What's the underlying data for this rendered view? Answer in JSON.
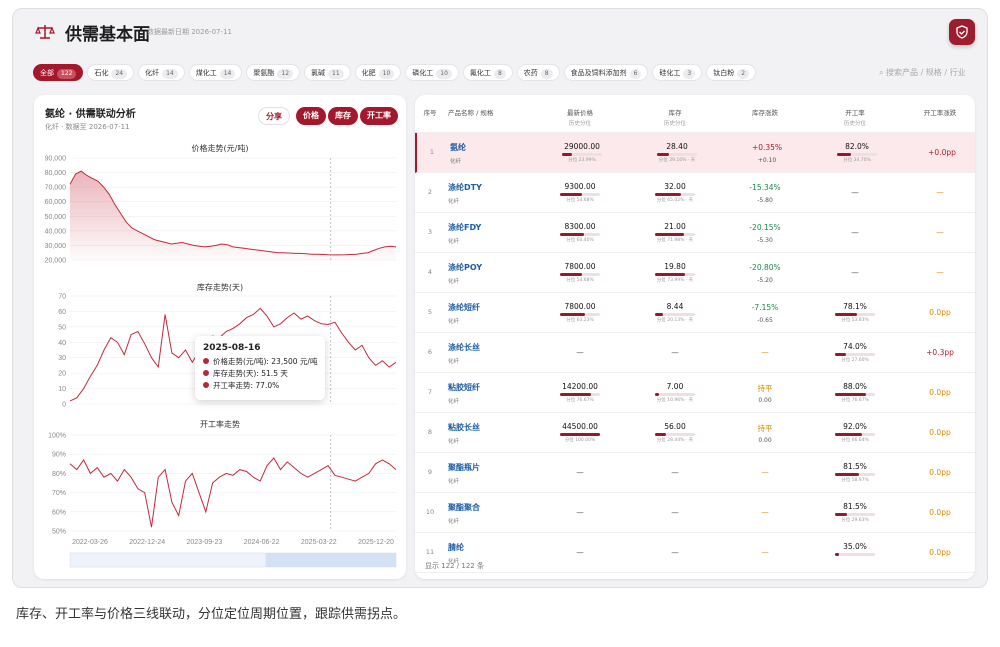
{
  "header": {
    "title": "供需基本面",
    "subtitle": "数据最新日期 2026-07-11",
    "search_placeholder": "搜索产品 / 规格 / 行业",
    "brand_color": "#a3192b"
  },
  "chips": [
    {
      "label": "全部",
      "count": "122"
    },
    {
      "label": "石化",
      "count": "24"
    },
    {
      "label": "化纤",
      "count": "14"
    },
    {
      "label": "煤化工",
      "count": "14"
    },
    {
      "label": "聚氨酯",
      "count": "12"
    },
    {
      "label": "氯碱",
      "count": "11"
    },
    {
      "label": "化肥",
      "count": "10"
    },
    {
      "label": "磷化工",
      "count": "10"
    },
    {
      "label": "氟化工",
      "count": "8"
    },
    {
      "label": "农药",
      "count": "8"
    },
    {
      "label": "食品及饲料添加剂",
      "count": "6"
    },
    {
      "label": "硅化工",
      "count": "3"
    },
    {
      "label": "钛白粉",
      "count": "2"
    }
  ],
  "left": {
    "title": "氨纶 · 供需联动分析",
    "subtitle": "化纤 · 数据至 2026-07-11",
    "buttons": {
      "share": "分享",
      "price": "价格",
      "stock": "库存",
      "rate": "开工率"
    }
  },
  "chart_data": [
    {
      "type": "area",
      "title": "价格走势(元/吨)",
      "ylim": [
        20000,
        90000
      ],
      "yticks": [
        "90,000",
        "80,000",
        "70,000",
        "60,000",
        "50,000",
        "40,000",
        "30,000",
        "20,000"
      ],
      "values": [
        72000,
        79000,
        81000,
        78000,
        76000,
        74000,
        70000,
        65000,
        58000,
        52000,
        46000,
        42000,
        40000,
        38000,
        36000,
        34000,
        33000,
        32000,
        31000,
        31500,
        32000,
        31000,
        30000,
        29500,
        29000,
        29500,
        30000,
        31000,
        30500,
        29000,
        28500,
        28000,
        27500,
        27000,
        26500,
        26000,
        25500,
        25000,
        25000,
        24800,
        24500,
        24500,
        24300,
        24000,
        24000,
        23800,
        23600,
        23500,
        23500,
        23600,
        23800,
        24000,
        24500,
        25000,
        26500,
        28000,
        29000,
        29500,
        29000
      ]
    },
    {
      "type": "line",
      "title": "库存走势(天)",
      "ylim": [
        0,
        70
      ],
      "yticks": [
        "70",
        "60",
        "50",
        "40",
        "30",
        "20",
        "10",
        "0"
      ],
      "values": [
        2,
        4,
        10,
        18,
        25,
        35,
        43,
        40,
        32,
        45,
        47,
        39,
        30,
        24,
        58,
        33,
        30,
        35,
        27,
        34,
        39,
        44,
        43,
        47,
        49,
        52,
        56,
        58,
        62,
        57,
        50,
        52,
        56,
        59,
        55,
        57,
        54,
        52,
        51.5,
        53,
        46,
        40,
        35,
        38,
        30,
        25,
        28,
        24,
        27
      ]
    },
    {
      "type": "line",
      "title": "开工率走势",
      "ylim": [
        50,
        100
      ],
      "yticks": [
        "100%",
        "90%",
        "80%",
        "70%",
        "60%",
        "50%"
      ],
      "x_ticks": [
        "2022-03-26",
        "2022-12-24",
        "2023-09-23",
        "2024-06-22",
        "2025-03-22",
        "2025-12-20"
      ],
      "values": [
        85,
        82,
        87,
        80,
        83,
        78,
        80,
        76,
        82,
        78,
        72,
        70,
        52,
        78,
        82,
        65,
        58,
        76,
        80,
        70,
        60,
        75,
        78,
        80,
        79,
        82,
        81,
        78,
        76,
        84,
        88,
        82,
        86,
        83,
        80,
        78,
        80,
        82,
        84,
        79,
        78,
        77,
        76,
        78,
        80,
        85,
        87,
        85,
        82
      ]
    }
  ],
  "tooltip": {
    "date": "2025-08-16",
    "price": "价格走势(元/吨): 23,500 元/吨",
    "stock": "库存走势(天): 51.5 天",
    "rate": "开工率走势: 77.0%"
  },
  "table": {
    "headers": {
      "no": "序号",
      "name": "产品名称 / 规格",
      "price": "最新价格",
      "price_s": "历史分位",
      "stock": "库存",
      "stock_s": "历史分位",
      "sidx": "库存涨跌",
      "rate": "开工率",
      "rate_s": "历史分位",
      "ridx": "开工率涨跌"
    },
    "rows": [
      {
        "no": "1",
        "name": "氨纶",
        "cat": "化纤",
        "price": "29000.00",
        "pp": "分位 23.99%",
        "pf": 0.24,
        "stock": "28.40",
        "sp": "分位 29.16% · 天",
        "sf": 0.29,
        "chg": "+0.35%",
        "chg2": "+0.10",
        "ct": "up",
        "rate": "82.0%",
        "rp": "分位 34.70%",
        "rf": 0.35,
        "rchg": "+0.0pp",
        "rt": "up"
      },
      {
        "no": "2",
        "name": "涤纶DTY",
        "cat": "化纤",
        "price": "9300.00",
        "pp": "分位 54.68%",
        "pf": 0.55,
        "stock": "32.00",
        "sp": "分位 65.02% · 天",
        "sf": 0.65,
        "chg": "-15.34%",
        "chg2": "-5.80",
        "ct": "dn",
        "rate": "—",
        "rp": "",
        "rf": 0,
        "rchg": "—",
        "rt": "fl"
      },
      {
        "no": "3",
        "name": "涤纶FDY",
        "cat": "化纤",
        "price": "8300.00",
        "pp": "分位 60.40%",
        "pf": 0.6,
        "stock": "21.00",
        "sp": "分位 71.98% · 天",
        "sf": 0.72,
        "chg": "-20.15%",
        "chg2": "-5.30",
        "ct": "dn",
        "rate": "—",
        "rp": "",
        "rf": 0,
        "rchg": "—",
        "rt": "fl"
      },
      {
        "no": "4",
        "name": "涤纶POY",
        "cat": "化纤",
        "price": "7800.00",
        "pp": "分位 54.68%",
        "pf": 0.55,
        "stock": "19.80",
        "sp": "分位 73.99% · 天",
        "sf": 0.74,
        "chg": "-20.80%",
        "chg2": "-5.20",
        "ct": "dn",
        "rate": "—",
        "rp": "",
        "rf": 0,
        "rchg": "—",
        "rt": "fl"
      },
      {
        "no": "5",
        "name": "涤纶短纤",
        "cat": "化纤",
        "price": "7800.00",
        "pp": "分位 63.23%",
        "pf": 0.63,
        "stock": "8.44",
        "sp": "分位 20.13% · 天",
        "sf": 0.2,
        "chg": "-7.15%",
        "chg2": "-0.65",
        "ct": "dn",
        "rate": "78.1%",
        "rp": "分位 53.83%",
        "rf": 0.54,
        "rchg": "0.0pp",
        "rt": "fl"
      },
      {
        "no": "6",
        "name": "涤纶长丝",
        "cat": "化纤",
        "price": "—",
        "pp": "",
        "pf": 0,
        "stock": "—",
        "sp": "",
        "sf": 0,
        "chg": "—",
        "chg2": "",
        "ct": "fl",
        "rate": "74.0%",
        "rp": "分位 27.60%",
        "rf": 0.28,
        "rchg": "+0.3pp",
        "rt": "up"
      },
      {
        "no": "7",
        "name": "粘胶短纤",
        "cat": "化纤",
        "price": "14200.00",
        "pp": "分位 76.67%",
        "pf": 0.77,
        "stock": "7.00",
        "sp": "分位 10.96% · 天",
        "sf": 0.11,
        "chg": "持平",
        "chg2": "0.00",
        "ct": "fl",
        "rate": "88.0%",
        "rp": "分位 76.67%",
        "rf": 0.77,
        "rchg": "0.0pp",
        "rt": "fl"
      },
      {
        "no": "8",
        "name": "粘胶长丝",
        "cat": "化纤",
        "price": "44500.00",
        "pp": "分位 100.00%",
        "pf": 1.0,
        "stock": "56.00",
        "sp": "分位 28.44% · 天",
        "sf": 0.28,
        "chg": "持平",
        "chg2": "0.00",
        "ct": "fl",
        "rate": "92.0%",
        "rp": "分位 66.64%",
        "rf": 0.67,
        "rchg": "0.0pp",
        "rt": "fl"
      },
      {
        "no": "9",
        "name": "聚酯瓶片",
        "cat": "化纤",
        "price": "—",
        "pp": "",
        "pf": 0,
        "stock": "—",
        "sp": "",
        "sf": 0,
        "chg": "—",
        "chg2": "",
        "ct": "fl",
        "rate": "81.5%",
        "rp": "分位 58.97%",
        "rf": 0.59,
        "rchg": "0.0pp",
        "rt": "fl"
      },
      {
        "no": "10",
        "name": "聚酯聚合",
        "cat": "化纤",
        "price": "—",
        "pp": "",
        "pf": 0,
        "stock": "—",
        "sp": "",
        "sf": 0,
        "chg": "—",
        "chg2": "",
        "ct": "fl",
        "rate": "81.5%",
        "rp": "分位 29.63%",
        "rf": 0.3,
        "rchg": "0.0pp",
        "rt": "fl"
      },
      {
        "no": "11",
        "name": "腈纶",
        "cat": "化纤",
        "price": "—",
        "pp": "",
        "pf": 0,
        "stock": "—",
        "sp": "",
        "sf": 0,
        "chg": "—",
        "chg2": "",
        "ct": "fl",
        "rate": "35.0%",
        "rp": "",
        "rf": 0.1,
        "rchg": "0.0pp",
        "rt": "fl"
      }
    ],
    "footer": "显示 122 / 122 条"
  },
  "caption": "库存、开工率与价格三线联动，分位定位周期位置，跟踪供需拐点。"
}
